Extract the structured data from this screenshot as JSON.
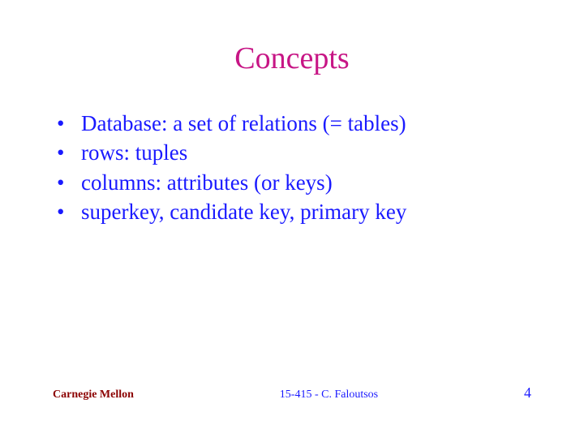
{
  "colors": {
    "title": "#c71585",
    "body": "#1a1aff",
    "footer_left": "#8b0000",
    "footer_center": "#1a1aff",
    "footer_right": "#1a1aff"
  },
  "title": "Concepts",
  "bullets": [
    "Database: a set of relations (= tables)",
    "rows: tuples",
    "columns: attributes (or keys)",
    "superkey, candidate key, primary key"
  ],
  "footer": {
    "left": "Carnegie Mellon",
    "center": "15-415 - C. Faloutsos",
    "right": "4"
  }
}
